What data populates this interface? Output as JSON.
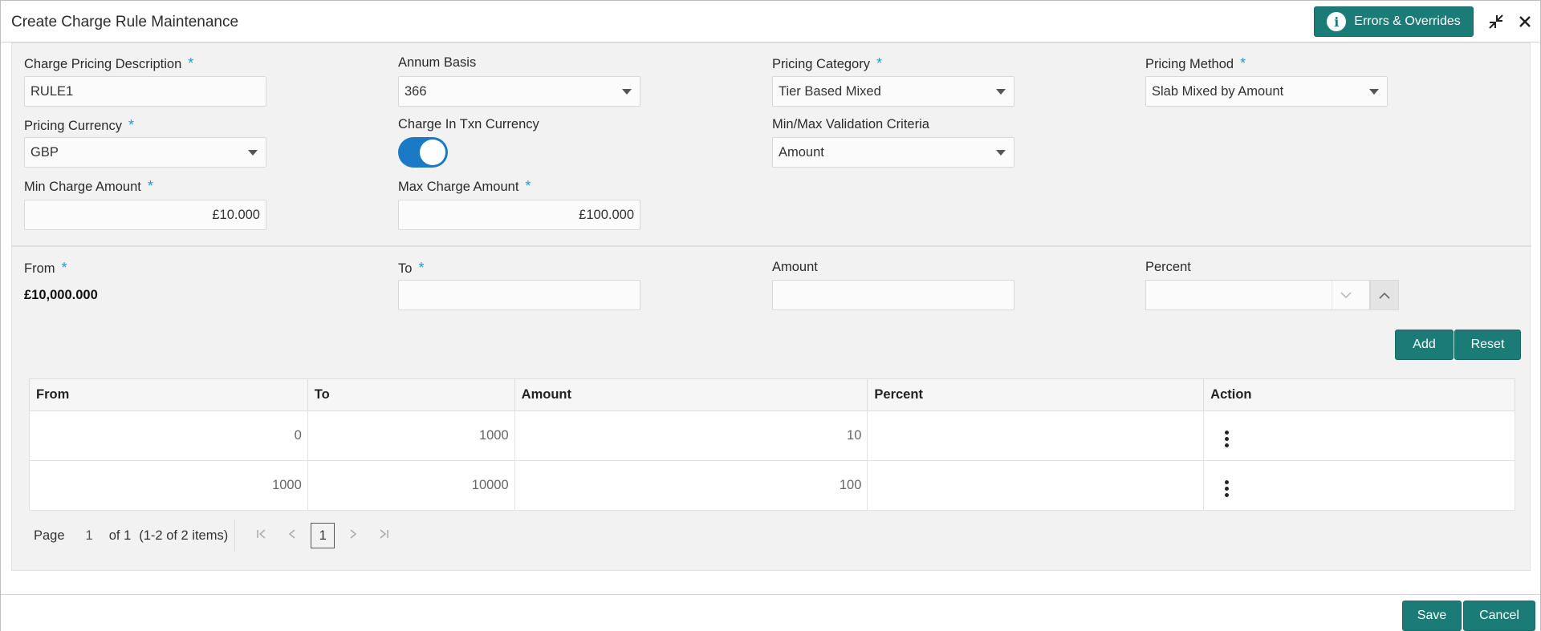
{
  "header": {
    "title": "Create Charge Rule Maintenance",
    "errors_label": "Errors & Overrides",
    "info_glyph": "i"
  },
  "form": {
    "charge_pricing_description": {
      "label": "Charge Pricing Description",
      "value": "RULE1"
    },
    "annum_basis": {
      "label": "Annum Basis",
      "value": "366"
    },
    "pricing_category": {
      "label": "Pricing Category",
      "value": "Tier Based Mixed"
    },
    "pricing_method": {
      "label": "Pricing Method",
      "value": "Slab Mixed by Amount"
    },
    "pricing_currency": {
      "label": "Pricing Currency",
      "value": "GBP"
    },
    "charge_in_txn_currency": {
      "label": "Charge In Txn Currency",
      "on": true
    },
    "min_max_validation": {
      "label": "Min/Max Validation Criteria",
      "value": "Amount"
    },
    "min_charge_amount": {
      "label": "Min Charge Amount",
      "value": "£10.000"
    },
    "max_charge_amount": {
      "label": "Max Charge Amount",
      "value": "£100.000"
    },
    "required_mark": "*"
  },
  "slab_entry": {
    "from_label": "From",
    "from_value": "£10,000.000",
    "to_label": "To",
    "to_value": "",
    "amount_label": "Amount",
    "amount_value": "",
    "percent_label": "Percent",
    "percent_value": ""
  },
  "buttons": {
    "add": "Add",
    "reset": "Reset",
    "save": "Save",
    "cancel": "Cancel"
  },
  "table": {
    "columns": [
      "From",
      "To",
      "Amount",
      "Percent",
      "Action"
    ],
    "rows": [
      {
        "from": "0",
        "to": "1000",
        "amount": "10",
        "percent": ""
      },
      {
        "from": "1000",
        "to": "10000",
        "amount": "100",
        "percent": ""
      }
    ]
  },
  "pagination": {
    "page_label": "Page",
    "page_value": "1",
    "of_label": "of 1",
    "items_label": "(1-2 of 2 items)",
    "current_page": "1"
  },
  "colors": {
    "accent": "#1b7c77",
    "toggle": "#1a7ac5",
    "required": "#1f9bd1"
  }
}
